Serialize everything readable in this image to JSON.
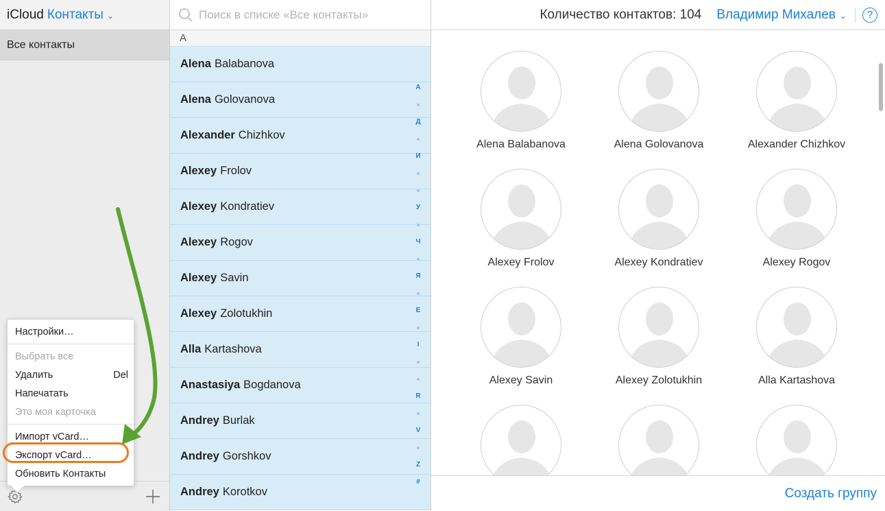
{
  "sidebar": {
    "brand": "iCloud",
    "app_name": "Контакты",
    "group": "Все контакты"
  },
  "menu": {
    "items": [
      {
        "label": "Настройки…",
        "shortcut": "",
        "disabled": false
      },
      {
        "label": "Выбрать все",
        "shortcut": "",
        "disabled": true
      },
      {
        "label": "Удалить",
        "shortcut": "Del",
        "disabled": false
      },
      {
        "label": "Напечатать",
        "shortcut": "",
        "disabled": false
      },
      {
        "label": "Это моя карточка",
        "shortcut": "",
        "disabled": true
      },
      {
        "label": "Импорт vCard…",
        "shortcut": "",
        "disabled": false
      },
      {
        "label": "Экспорт vCard…",
        "shortcut": "",
        "disabled": false
      },
      {
        "label": "Обновить Контакты",
        "shortcut": "",
        "disabled": false
      }
    ]
  },
  "search": {
    "placeholder": "Поиск в списке «Все контакты»"
  },
  "list": {
    "section": "A",
    "contacts": [
      {
        "first": "Alena",
        "last": "Balabanova"
      },
      {
        "first": "Alena",
        "last": "Golovanova"
      },
      {
        "first": "Alexander",
        "last": "Chizhkov"
      },
      {
        "first": "Alexey",
        "last": "Frolov"
      },
      {
        "first": "Alexey",
        "last": "Kondratiev"
      },
      {
        "first": "Alexey",
        "last": "Rogov"
      },
      {
        "first": "Alexey",
        "last": "Savin"
      },
      {
        "first": "Alexey",
        "last": "Zolotukhin"
      },
      {
        "first": "Alla",
        "last": "Kartashova"
      },
      {
        "first": "Anastasiya",
        "last": "Bogdanova"
      },
      {
        "first": "Andrey",
        "last": "Burlak"
      },
      {
        "first": "Andrey",
        "last": "Gorshkov"
      },
      {
        "first": "Andrey",
        "last": "Korotkov"
      }
    ],
    "index": [
      "А",
      "•",
      "Д",
      "•",
      "И",
      "•",
      "•",
      "У",
      "•",
      "Ч",
      "•",
      "Я",
      "•",
      "E",
      "•",
      "I",
      "•",
      "•",
      "R",
      "•",
      "V",
      "•",
      "Z",
      "#"
    ]
  },
  "header": {
    "count_text": "Количество контактов: 104",
    "user_name": "Владимир Михалев",
    "help": "?"
  },
  "cards": [
    "Alena Balabanova",
    "Alena Golovanova",
    "Alexander Chizhkov",
    "Alexey Frolov",
    "Alexey Kondratiev",
    "Alexey Rogov",
    "Alexey Savin",
    "Alexey Zolotukhin",
    "Alla Kartashova",
    "",
    "",
    ""
  ],
  "footer": {
    "create_group": "Создать группу"
  },
  "colors": {
    "accent": "#1a82d8",
    "selection": "#d8ecf8",
    "highlight_ring": "#ec7a1a",
    "arrow": "#5aa332"
  }
}
